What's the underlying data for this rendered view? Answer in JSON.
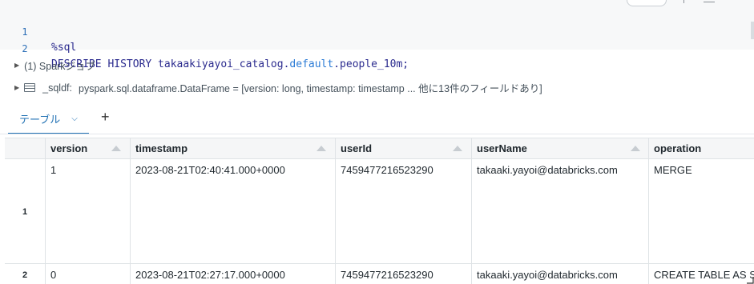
{
  "editor": {
    "lines": [
      {
        "num": "1",
        "text": "%sql"
      },
      {
        "num": "2",
        "text_before": "DESCRIBE HISTORY takaakiyayoi_catalog.",
        "text_keyword": "default",
        "text_after": ".people_10m;"
      }
    ]
  },
  "jobs": {
    "label": "(1) Sparkジョブ"
  },
  "dataframe": {
    "name": "_sqldf:",
    "type_text": "pyspark.sql.dataframe.DataFrame = [version: long, timestamp: timestamp ... 他に13件のフィールドあり]"
  },
  "tabs": {
    "active_label": "テーブル",
    "add_label": "+"
  },
  "table": {
    "columns": [
      "version",
      "timestamp",
      "userId",
      "userName",
      "operation"
    ],
    "rows": [
      {
        "num": "1",
        "cells": [
          "1",
          "2023-08-21T02:40:41.000+0000",
          "7459477216523290",
          "takaaki.yayoi@databricks.com",
          "MERGE"
        ]
      },
      {
        "num": "2",
        "cells": [
          "0",
          "2023-08-21T02:27:17.000+0000",
          "7459477216523290",
          "takaaki.yayoi@databricks.com",
          "CREATE TABLE AS SE"
        ]
      }
    ]
  },
  "icons": {
    "expand": "caret-right-icon",
    "table": "table-icon",
    "tab_menu": "chevron-down-icon",
    "sort": "sort-ascending-icon",
    "resize": "resize-grip-icon"
  },
  "colors": {
    "accent": "#2272b4",
    "header_bg": "#f5f6f7",
    "editor_bg": "#f7f8f9"
  }
}
